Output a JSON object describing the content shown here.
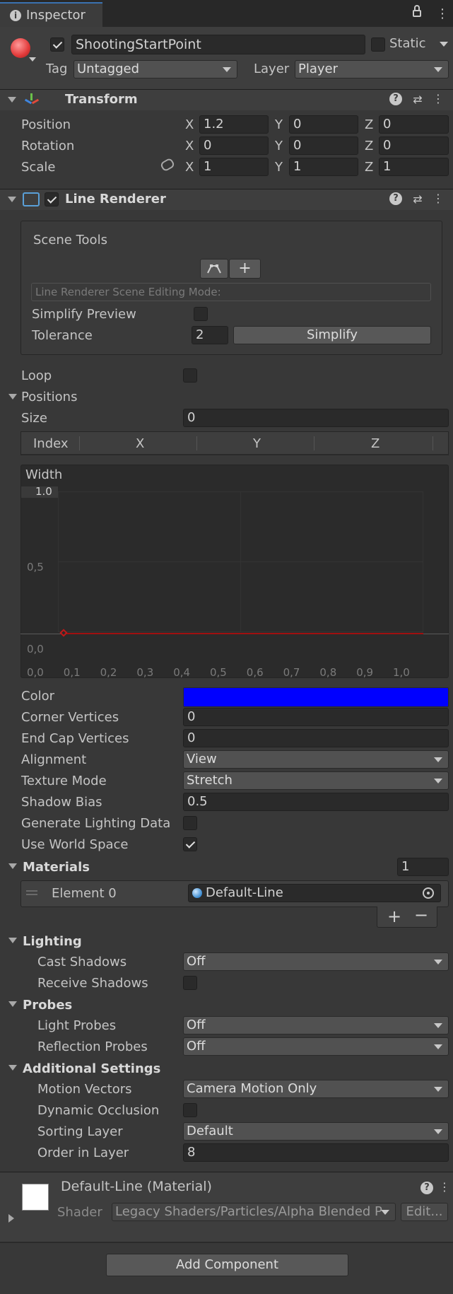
{
  "tab": {
    "title": "Inspector"
  },
  "object": {
    "name": "ShootingStartPoint",
    "static_label": "Static",
    "tag_label": "Tag",
    "tag_value": "Untagged",
    "layer_label": "Layer",
    "layer_value": "Player"
  },
  "transform": {
    "title": "Transform",
    "rows": [
      {
        "label": "Position",
        "x": "1.2",
        "y": "0",
        "z": "0"
      },
      {
        "label": "Rotation",
        "x": "0",
        "y": "0",
        "z": "0"
      },
      {
        "label": "Scale",
        "x": "1",
        "y": "1",
        "z": "1"
      }
    ],
    "axis": {
      "x": "X",
      "y": "Y",
      "z": "Z"
    }
  },
  "line_renderer": {
    "title": "Line Renderer",
    "scene_tools": {
      "title": "Scene Tools",
      "mode_placeholder": "Line Renderer Scene Editing Mode:",
      "simplify_preview": "Simplify Preview",
      "tolerance_label": "Tolerance",
      "tolerance_value": "2",
      "simplify_button": "Simplify"
    },
    "loop_label": "Loop",
    "positions_label": "Positions",
    "size_label": "Size",
    "size_value": "0",
    "table_headers": [
      "Index",
      "X",
      "Y",
      "Z"
    ],
    "width": {
      "title": "Width",
      "y_ticks": [
        "1.0",
        "0,5",
        "0,0"
      ],
      "x_ticks": [
        "0,0",
        "0,1",
        "0,2",
        "0,3",
        "0,4",
        "0,5",
        "0,6",
        "0,7",
        "0,8",
        "0,9",
        "1,0"
      ]
    },
    "props": [
      {
        "label": "Color",
        "value": ""
      },
      {
        "label": "Corner Vertices",
        "value": "0"
      },
      {
        "label": "End Cap Vertices",
        "value": "0"
      },
      {
        "label": "Alignment",
        "value": "View"
      },
      {
        "label": "Texture Mode",
        "value": "Stretch"
      },
      {
        "label": "Shadow Bias",
        "value": "0.5"
      },
      {
        "label": "Generate Lighting Data",
        "value": ""
      },
      {
        "label": "Use World Space",
        "value": ""
      }
    ],
    "color_value": "#0000ff",
    "materials": {
      "label": "Materials",
      "count": "1",
      "element_label": "Element 0",
      "element_value": "Default-Line"
    },
    "lighting": {
      "label": "Lighting",
      "cast_label": "Cast Shadows",
      "cast_value": "Off",
      "receive_label": "Receive Shadows"
    },
    "probes": {
      "label": "Probes",
      "light_label": "Light Probes",
      "light_value": "Off",
      "reflection_label": "Reflection Probes",
      "reflection_value": "Off"
    },
    "additional": {
      "label": "Additional Settings",
      "motion_label": "Motion Vectors",
      "motion_value": "Camera Motion Only",
      "dynamic_label": "Dynamic Occlusion",
      "sorting_label": "Sorting Layer",
      "sorting_value": "Default",
      "order_label": "Order in Layer",
      "order_value": "8"
    }
  },
  "material": {
    "title": "Default-Line (Material)",
    "shader_label": "Shader",
    "shader_value": "Legacy Shaders/Particles/Alpha Blended P",
    "edit_label": "Edit..."
  },
  "add_component": "Add Component"
}
